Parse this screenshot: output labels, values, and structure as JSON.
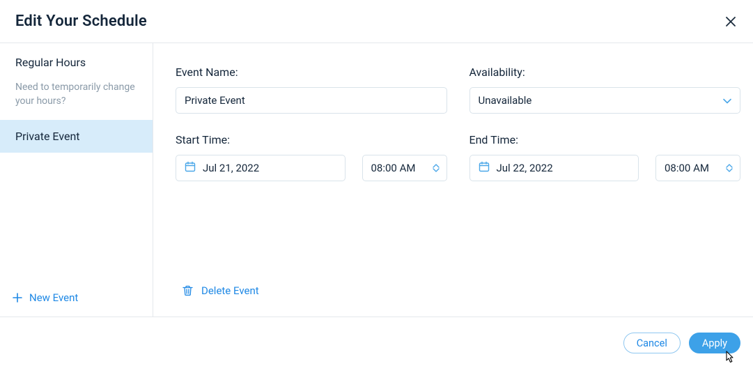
{
  "header": {
    "title": "Edit Your Schedule"
  },
  "sidebar": {
    "regular_hours_label": "Regular Hours",
    "note": "Need to temporarily change your hours?",
    "active_event_label": "Private Event",
    "new_event_label": "New Event"
  },
  "form": {
    "event_name_label": "Event Name:",
    "event_name_value": "Private Event",
    "availability_label": "Availability:",
    "availability_value": "Unavailable",
    "start_time_label": "Start Time:",
    "start_date_value": "Jul 21, 2022",
    "start_time_value": "08:00 AM",
    "end_time_label": "End Time:",
    "end_date_value": "Jul 22, 2022",
    "end_time_value": "08:00 AM",
    "delete_label": "Delete Event"
  },
  "footer": {
    "cancel_label": "Cancel",
    "apply_label": "Apply"
  },
  "icons": {
    "close": "close-icon",
    "plus": "plus-icon",
    "calendar": "calendar-icon",
    "chevron_down": "chevron-down-icon",
    "chevron_up": "chevron-up-icon",
    "trash": "trash-icon"
  }
}
